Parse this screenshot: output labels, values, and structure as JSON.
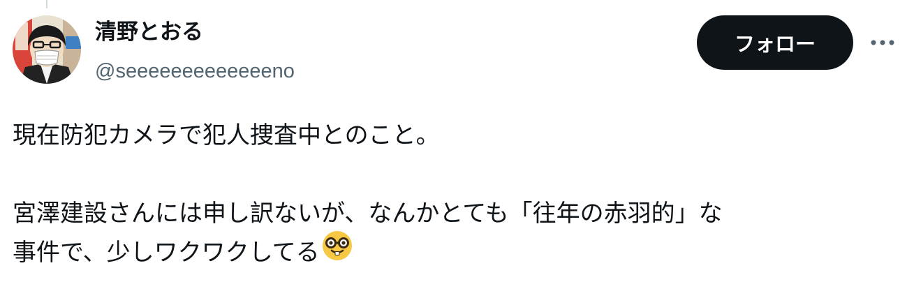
{
  "author": {
    "display_name": "清野とおる",
    "handle": "@seeeeeeeeeeeeeno"
  },
  "actions": {
    "follow_label": "フォロー",
    "more_icon": "more-horizontal-icon"
  },
  "tweet": {
    "lines": [
      "現在防犯カメラで犯人捜査中とのこと。",
      "",
      "宮澤建設さんには申し訳ないが、なんかとても「往年の赤羽的」な",
      "事件で、少しワクワクしてる"
    ],
    "trailing_emoji": "nerd-face-emoji"
  },
  "colors": {
    "text_primary": "#0f1419",
    "text_secondary": "#536471",
    "button_bg": "#0f1419",
    "button_text": "#ffffff",
    "emoji_yellow": "#f7c844"
  }
}
